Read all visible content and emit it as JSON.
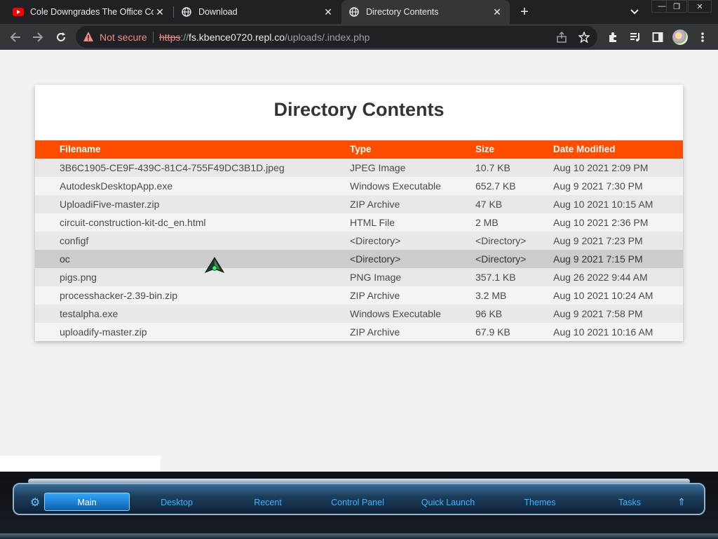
{
  "tabs": [
    {
      "title": "Cole Downgrades The Office Computer",
      "icon": "youtube-icon",
      "active": false
    },
    {
      "title": "Download",
      "icon": "globe-icon",
      "active": false
    },
    {
      "title": "Directory Contents",
      "icon": "globe-icon",
      "active": true
    }
  ],
  "toolbar": {
    "security_label": "Not secure",
    "url_scheme": "https",
    "url_host": "fs.kbence0720.repl.co",
    "url_path": "/uploads/.index.php"
  },
  "page": {
    "title": "Directory Contents",
    "columns": [
      "Filename",
      "Type",
      "Size",
      "Date Modified"
    ],
    "rows": [
      {
        "name": "3B6C1905-CE9F-439C-81C4-755F49DC3B1D.jpeg",
        "type": "JPEG Image",
        "size": "10.7 KB",
        "date": "Aug 10 2021 2:09 PM"
      },
      {
        "name": "AutodeskDesktopApp.exe",
        "type": "Windows Executable",
        "size": "652.7 KB",
        "date": "Aug 9 2021 7:30 PM"
      },
      {
        "name": "UploadiFive-master.zip",
        "type": "ZIP Archive",
        "size": "47 KB",
        "date": "Aug 10 2021 10:15 AM"
      },
      {
        "name": "circuit-construction-kit-dc_en.html",
        "type": "HTML File",
        "size": "2 MB",
        "date": "Aug 10 2021 2:36 PM"
      },
      {
        "name": "configf",
        "type": "<Directory>",
        "size": "<Directory>",
        "date": "Aug 9 2021 7:23 PM"
      },
      {
        "name": "oc",
        "type": "<Directory>",
        "size": "<Directory>",
        "date": "Aug 9 2021 7:15 PM"
      },
      {
        "name": "pigs.png",
        "type": "PNG Image",
        "size": "357.1 KB",
        "date": "Aug 26 2022 9:44 AM"
      },
      {
        "name": "processhacker-2.39-bin.zip",
        "type": "ZIP Archive",
        "size": "3.2 MB",
        "date": "Aug 10 2021 10:24 AM"
      },
      {
        "name": "testalpha.exe",
        "type": "Windows Executable",
        "size": "96 KB",
        "date": "Aug 9 2021 7:58 PM"
      },
      {
        "name": "uploadify-master.zip",
        "type": "ZIP Archive",
        "size": "67.9 KB",
        "date": "Aug 10 2021 10:16 AM"
      }
    ]
  },
  "taskbar": {
    "items": [
      "Main",
      "Desktop",
      "Recent",
      "Control Panel",
      "Quick Launch",
      "Themes",
      "Tasks"
    ]
  },
  "colors": {
    "header_accent": "#ff4d00",
    "taskbar_text": "#3fb6ff",
    "not_secure": "#f28b82"
  }
}
